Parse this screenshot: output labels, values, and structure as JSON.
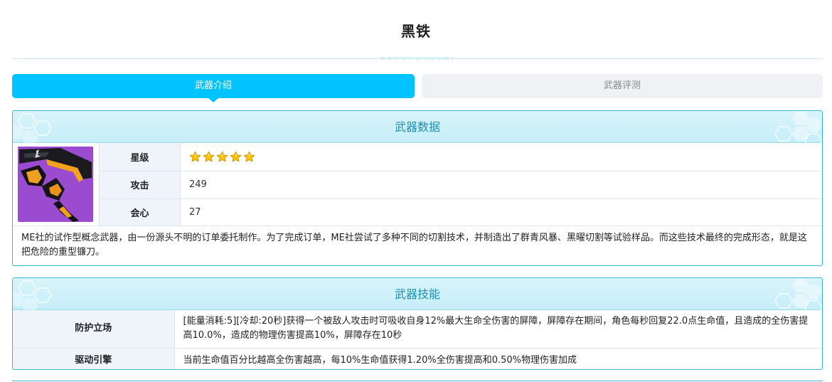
{
  "page": {
    "title": "黑铁"
  },
  "tabs": [
    {
      "label": "武器介绍",
      "active": true
    },
    {
      "label": "武器评测",
      "active": false
    }
  ],
  "weapon_data": {
    "heading": "武器数据",
    "image_icon": "weapon-scythe-icon",
    "stats": [
      {
        "label": "星级",
        "stars": 5
      },
      {
        "label": "攻击",
        "value": "249"
      },
      {
        "label": "会心",
        "value": "27"
      }
    ],
    "description": "ME社的试作型概念武器，由一份源头不明的订单委托制作。为了完成订单，ME社尝试了多种不同的切割技术，并制造出了群青风暴、黑曜切割等试验样品。而这些技术最终的完成形态，就是这把危险的重型镰刀。"
  },
  "weapon_skills": {
    "heading": "武器技能",
    "rows": [
      {
        "name": "防护立场",
        "desc": "[能量消耗:5][冷却:20秒]获得一个被敌人攻击时可吸收自身12%最大生命全伤害的屏障，屏障存在期间，角色每秒回复22.0点生命值，且造成的全伤害提高10.0%，造成的物理伤害提高10%，屏障存在10秒"
      },
      {
        "name": "驱动引擎",
        "desc": "当前生命值百分比越高全伤害越高，每10%生命值获得1.20%全伤害提高和0.50%物理伤害加成"
      }
    ]
  },
  "colors": {
    "accent": "#00c3ff",
    "panel_border": "#3ab7d8",
    "heading_text": "#1c8fb3",
    "weapon_bg": "#9a4bd0",
    "star": "#ffc400"
  }
}
